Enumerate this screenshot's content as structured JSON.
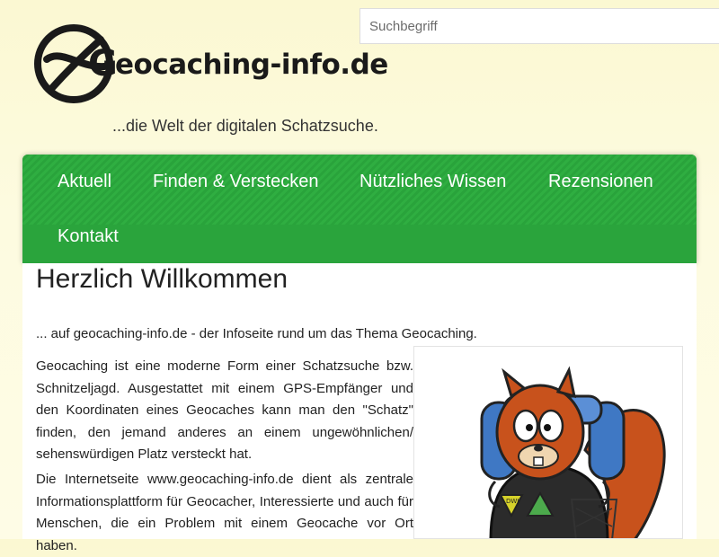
{
  "search": {
    "placeholder": "Suchbegriff"
  },
  "logo": {
    "first_letter": "G",
    "text": "eocaching-info.de"
  },
  "tagline": "...die Welt der digitalen Schatzsuche.",
  "nav": {
    "items": [
      {
        "label": "Aktuell"
      },
      {
        "label": "Finden & Verstecken"
      },
      {
        "label": "Nützliches Wissen"
      },
      {
        "label": "Rezensionen"
      },
      {
        "label": "Kontakt"
      }
    ]
  },
  "main": {
    "title": "Herzlich Willkommen",
    "intro": "... auf geocaching-info.de - der Infoseite rund um das Thema Geocaching.",
    "paragraph1": "Geocaching ist eine moderne Form einer Schatzsuche bzw. Schnitzeljagd. Ausgestattet mit einem GPS-Empfänger und den Koordinaten eines Geocaches kann man den \"Schatz\" finden, den jemand anderes an einem ungewöhnlichen/ sehenswürdigen Platz versteckt hat.",
    "paragraph2": "Die Internetseite www.geocaching-info.de dient als zentrale Informationsplattform für Geocacher, Interessierte und auch für Menschen, die ein Problem mit einem Geocache vor Ort haben."
  },
  "mascot": {
    "badge_text": "DWJ"
  },
  "colors": {
    "nav_green": "#2aa43c",
    "background": "#fdfbe0"
  }
}
